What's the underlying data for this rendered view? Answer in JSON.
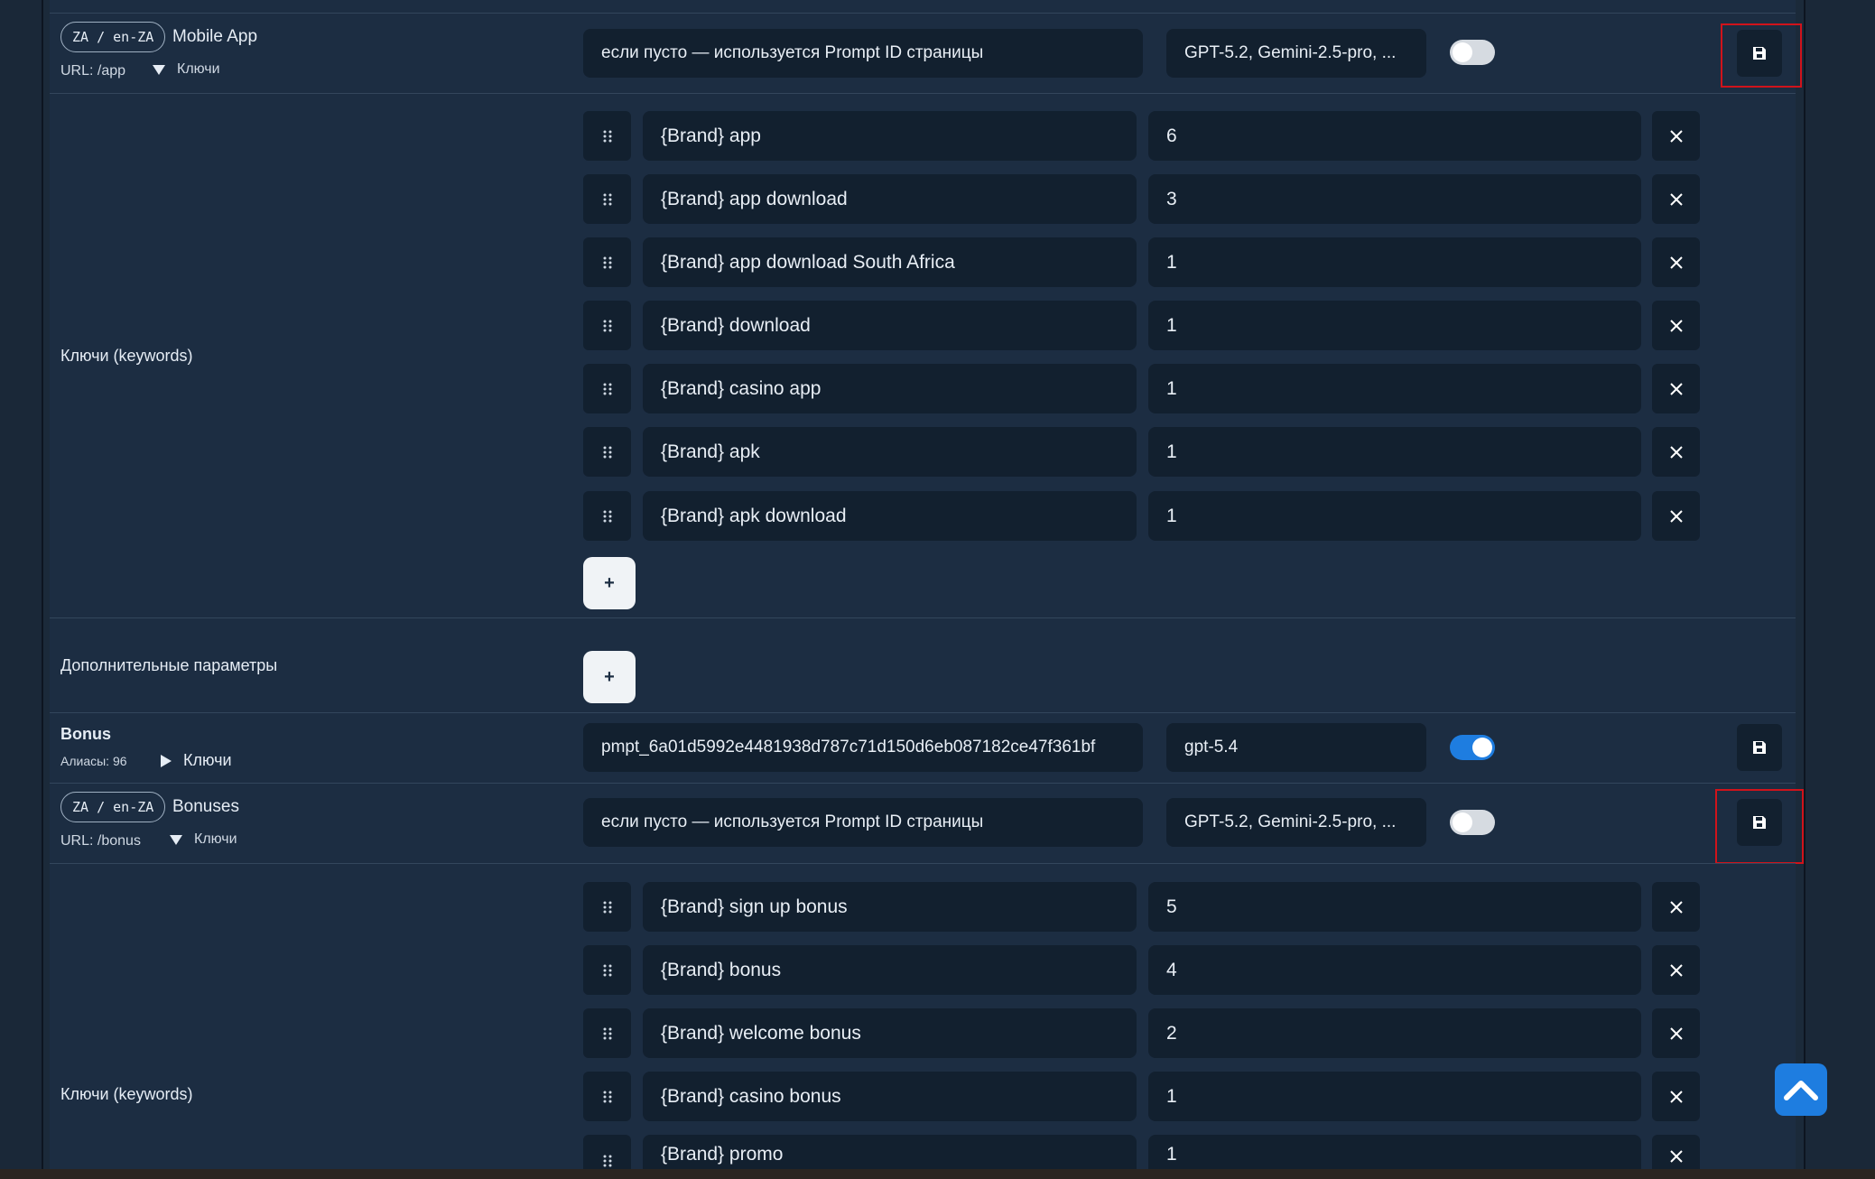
{
  "sections": [
    {
      "group": "",
      "locale": "ZA / en-ZA",
      "title": "Mobile App",
      "url": "URL: /app",
      "keys_toggle": "Ключи",
      "prompt_placeholder": "если пусто — используется Prompt ID страницы",
      "models": "GPT-5.2, Gemini-2.5-pro, ...",
      "enabled": false,
      "keywords_label": "Ключи (keywords)",
      "keywords": [
        {
          "text": "{Brand} app",
          "weight": "6"
        },
        {
          "text": "{Brand} app download",
          "weight": "3"
        },
        {
          "text": "{Brand} app download South Africa",
          "weight": "1"
        },
        {
          "text": "{Brand} download",
          "weight": "1"
        },
        {
          "text": "{Brand} casino app",
          "weight": "1"
        },
        {
          "text": "{Brand} apk",
          "weight": "1"
        },
        {
          "text": "{Brand} apk download",
          "weight": "1"
        }
      ],
      "add_label": "+",
      "extra_label": "Дополнительные параметры",
      "extra_add_label": "+"
    }
  ],
  "bonus_group": {
    "title": "Bonus",
    "aliases": "Алиасы: 96",
    "keys_toggle": "Ключи",
    "prompt_id": "pmpt_6a01d5992e4481938d787c71d150d6eb087182ce47f361bf",
    "model": "gpt-5.4",
    "enabled": true
  },
  "bonuses": {
    "locale": "ZA / en-ZA",
    "title": "Bonuses",
    "url": "URL: /bonus",
    "keys_toggle": "Ключи",
    "prompt_placeholder": "если пусто — используется Prompt ID страницы",
    "models": "GPT-5.2, Gemini-2.5-pro, ...",
    "enabled": false,
    "keywords_label": "Ключи (keywords)",
    "keywords": [
      {
        "text": "{Brand} sign up bonus",
        "weight": "5"
      },
      {
        "text": "{Brand} bonus",
        "weight": "4"
      },
      {
        "text": "{Brand} welcome bonus",
        "weight": "2"
      },
      {
        "text": "{Brand} casino bonus",
        "weight": "1"
      },
      {
        "text": "{Brand} promo",
        "weight": "1"
      }
    ]
  },
  "icons": {
    "save": "save-icon",
    "drag": "drag-handle-icon",
    "remove": "close-icon",
    "triangle_down": "triangle-down-icon",
    "triangle_right": "triangle-right-icon",
    "scroll_top": "chevron-up-icon"
  },
  "colors": {
    "panel": "#1c2d42",
    "input": "#12202f",
    "accent": "#1e7de0",
    "highlight": "#d0131b"
  }
}
